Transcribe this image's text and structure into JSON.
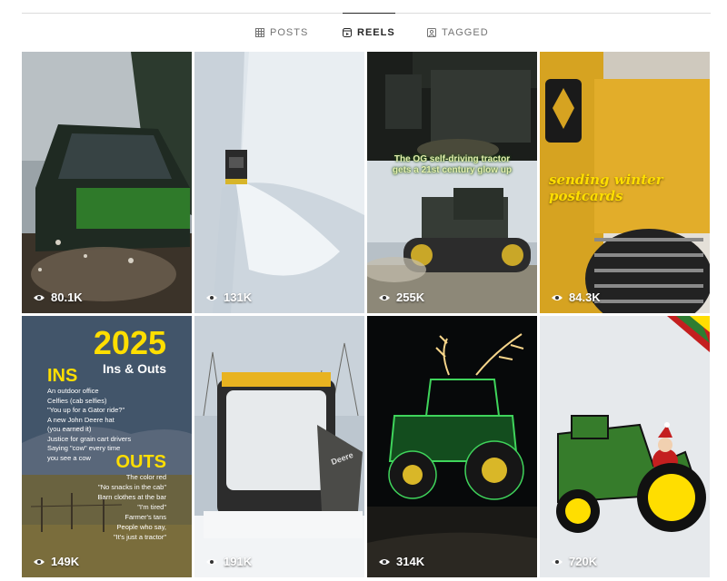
{
  "tabs": [
    {
      "label": "POSTS",
      "icon": "grid-icon",
      "active": false
    },
    {
      "label": "REELS",
      "icon": "reels-icon",
      "active": true
    },
    {
      "label": "TAGGED",
      "icon": "tagged-icon",
      "active": false
    }
  ],
  "reels": [
    {
      "views": "80.1K",
      "subject": "gator-splash"
    },
    {
      "views": "131K",
      "subject": "snow-blower-aerial"
    },
    {
      "views": "255K",
      "subject": "tracked-tractor",
      "caption_line1": "The OG self-driving tractor",
      "caption_line2": "gets a 21st century glow up"
    },
    {
      "views": "84.3K",
      "subject": "winter-postcards",
      "caption": "sending winter postcards"
    },
    {
      "views": "149K",
      "subject": "ins-and-outs",
      "year": "2025",
      "subtitle": "Ins & Outs",
      "ins_heading": "INS",
      "ins": [
        "An outdoor office",
        "Celfies (cab selfies)",
        "\"You up for a Gator ride?\"",
        "A new John Deere hat",
        "(you earned it)",
        "Justice for grain cart drivers",
        "Saying \"cow\" every time",
        "you see a cow"
      ],
      "outs_heading": "OUTS",
      "outs": [
        "The color red",
        "\"No snacks in the cab\"",
        "Barn clothes at the bar",
        "\"I'm tired\"",
        "Farmer's tans",
        "People who say,",
        "\"It's just a tractor\""
      ]
    },
    {
      "views": "191K",
      "subject": "snowy-skid-steer",
      "brand": "Deere"
    },
    {
      "views": "314K",
      "subject": "lit-reindeer-tractor"
    },
    {
      "views": "720K",
      "subject": "santa-tractor-cookie"
    }
  ],
  "colors": {
    "deere_green": "#367c2b",
    "deere_yellow": "#ffde00"
  }
}
